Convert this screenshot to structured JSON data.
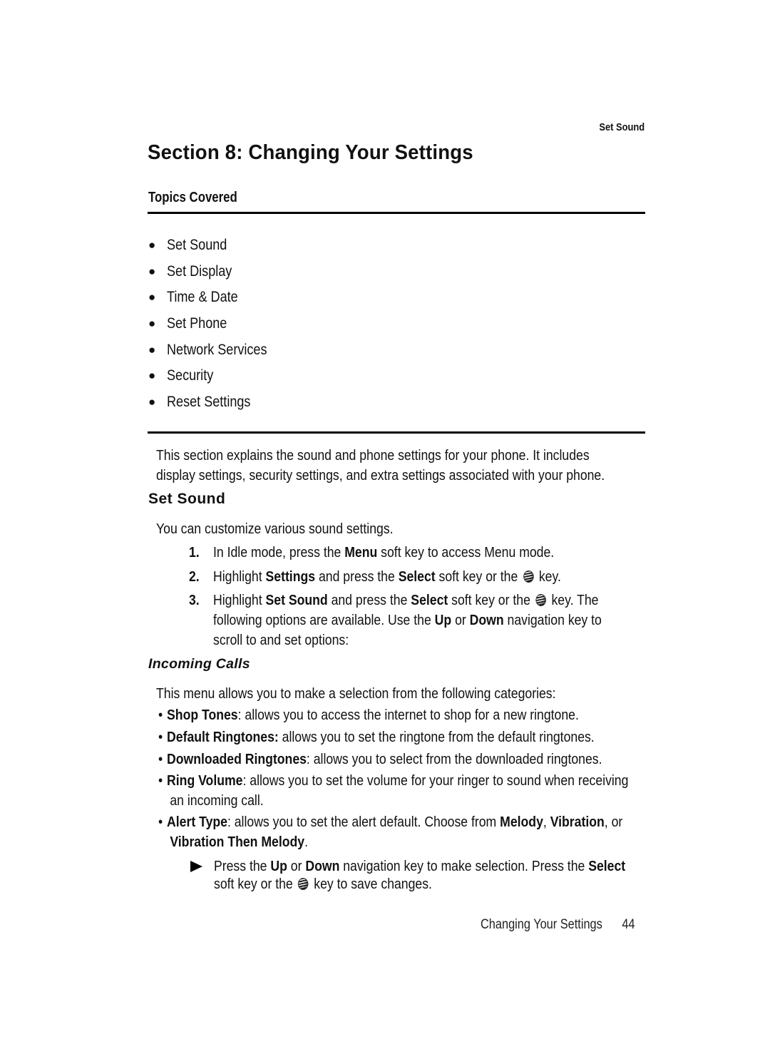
{
  "running_head": "Set Sound",
  "section_title": "Section 8: Changing Your Settings",
  "topics": {
    "heading": "Topics Covered",
    "items": [
      "Set Sound",
      "Set Display",
      "Time & Date",
      "Set Phone",
      "Network Services",
      "Security",
      "Reset Settings"
    ]
  },
  "intro": {
    "line1": "This section explains the sound and phone settings for your phone. It includes",
    "line2": "display settings, security settings, and extra settings associated with your phone."
  },
  "set_sound": {
    "heading": "Set Sound",
    "description": "You can customize various sound settings.",
    "steps": [
      {
        "num": "1.",
        "a": "In Idle mode, press the ",
        "b1": "Menu",
        "c": " soft key to access Menu mode."
      },
      {
        "num": "2.",
        "a": "Highlight ",
        "b1": "Settings",
        "c": " and press the ",
        "b2": "Select",
        "d": " soft key or the ",
        "e": " key."
      },
      {
        "num": "3.",
        "a": "Highlight ",
        "b1": "Set Sound",
        "c": " and press the ",
        "b2": "Select",
        "d": " soft key or the ",
        "e": " key. The",
        "line2a": "following options are available. Use the ",
        "line2b": "Up",
        "line2c": " or ",
        "line2d": "Down",
        "line2e": " navigation key to",
        "line3": "scroll to and set options:"
      }
    ],
    "key_icon": "att-globe-key-icon"
  },
  "incoming_calls": {
    "heading": "Incoming Calls",
    "intro": "This menu allows you to make a selection from the following categories:",
    "items": [
      {
        "term": "Shop Tones",
        "sep": ":",
        "desc": " allows you to access the internet to shop for a new ringtone."
      },
      {
        "term": "Default Ringtones:",
        "sep": "",
        "desc": " allows you to set the ringtone from the default ringtones."
      },
      {
        "term": "Downloaded Ringtones",
        "sep": ":",
        "desc": " allows you to select from the downloaded ringtones."
      },
      {
        "term": "Ring Volume",
        "sep": ":",
        "desc": " allows you to set the volume for your ringer to sound when receiving",
        "cont": "an incoming call."
      },
      {
        "term": "Alert Type",
        "sep": ":",
        "desc": " allows you to set the alert default. Choose from ",
        "opt1": "Melody",
        "comma": ", ",
        "opt2": "Vibration",
        "or": ", or",
        "opt3": "Vibration Then Melody",
        "end": "."
      }
    ],
    "note": {
      "a": "Press the ",
      "up": "Up",
      "or": " or ",
      "down": "Down",
      "b": " navigation key to make selection. Press the ",
      "select": "Select",
      "line2a": "soft key or the ",
      "line2b": " key to save changes."
    }
  },
  "footer": {
    "title": "Changing Your Settings",
    "page": "44"
  }
}
